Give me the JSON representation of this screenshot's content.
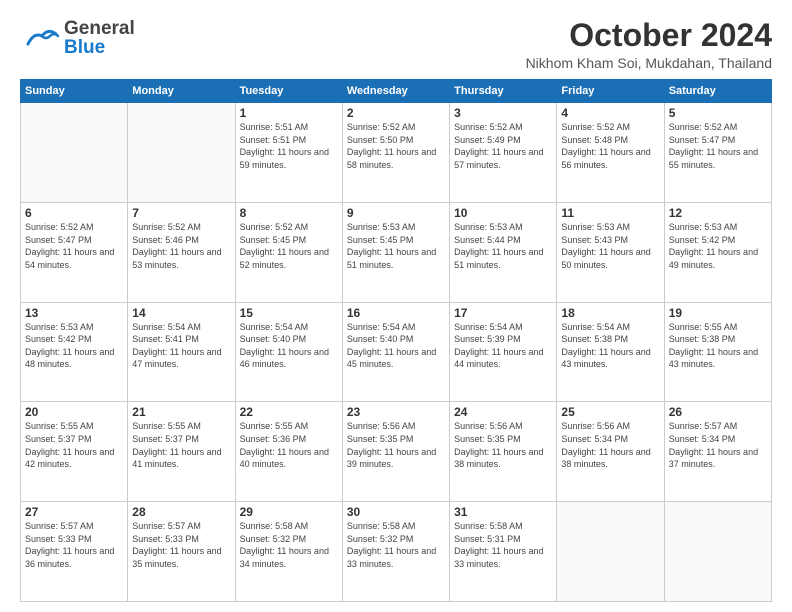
{
  "header": {
    "logo_line1": "General",
    "logo_line2": "Blue",
    "month": "October 2024",
    "location": "Nikhom Kham Soi, Mukdahan, Thailand"
  },
  "weekdays": [
    "Sunday",
    "Monday",
    "Tuesday",
    "Wednesday",
    "Thursday",
    "Friday",
    "Saturday"
  ],
  "weeks": [
    [
      {
        "day": "",
        "info": ""
      },
      {
        "day": "",
        "info": ""
      },
      {
        "day": "1",
        "info": "Sunrise: 5:51 AM\nSunset: 5:51 PM\nDaylight: 11 hours and 59 minutes."
      },
      {
        "day": "2",
        "info": "Sunrise: 5:52 AM\nSunset: 5:50 PM\nDaylight: 11 hours and 58 minutes."
      },
      {
        "day": "3",
        "info": "Sunrise: 5:52 AM\nSunset: 5:49 PM\nDaylight: 11 hours and 57 minutes."
      },
      {
        "day": "4",
        "info": "Sunrise: 5:52 AM\nSunset: 5:48 PM\nDaylight: 11 hours and 56 minutes."
      },
      {
        "day": "5",
        "info": "Sunrise: 5:52 AM\nSunset: 5:47 PM\nDaylight: 11 hours and 55 minutes."
      }
    ],
    [
      {
        "day": "6",
        "info": "Sunrise: 5:52 AM\nSunset: 5:47 PM\nDaylight: 11 hours and 54 minutes."
      },
      {
        "day": "7",
        "info": "Sunrise: 5:52 AM\nSunset: 5:46 PM\nDaylight: 11 hours and 53 minutes."
      },
      {
        "day": "8",
        "info": "Sunrise: 5:52 AM\nSunset: 5:45 PM\nDaylight: 11 hours and 52 minutes."
      },
      {
        "day": "9",
        "info": "Sunrise: 5:53 AM\nSunset: 5:45 PM\nDaylight: 11 hours and 51 minutes."
      },
      {
        "day": "10",
        "info": "Sunrise: 5:53 AM\nSunset: 5:44 PM\nDaylight: 11 hours and 51 minutes."
      },
      {
        "day": "11",
        "info": "Sunrise: 5:53 AM\nSunset: 5:43 PM\nDaylight: 11 hours and 50 minutes."
      },
      {
        "day": "12",
        "info": "Sunrise: 5:53 AM\nSunset: 5:42 PM\nDaylight: 11 hours and 49 minutes."
      }
    ],
    [
      {
        "day": "13",
        "info": "Sunrise: 5:53 AM\nSunset: 5:42 PM\nDaylight: 11 hours and 48 minutes."
      },
      {
        "day": "14",
        "info": "Sunrise: 5:54 AM\nSunset: 5:41 PM\nDaylight: 11 hours and 47 minutes."
      },
      {
        "day": "15",
        "info": "Sunrise: 5:54 AM\nSunset: 5:40 PM\nDaylight: 11 hours and 46 minutes."
      },
      {
        "day": "16",
        "info": "Sunrise: 5:54 AM\nSunset: 5:40 PM\nDaylight: 11 hours and 45 minutes."
      },
      {
        "day": "17",
        "info": "Sunrise: 5:54 AM\nSunset: 5:39 PM\nDaylight: 11 hours and 44 minutes."
      },
      {
        "day": "18",
        "info": "Sunrise: 5:54 AM\nSunset: 5:38 PM\nDaylight: 11 hours and 43 minutes."
      },
      {
        "day": "19",
        "info": "Sunrise: 5:55 AM\nSunset: 5:38 PM\nDaylight: 11 hours and 43 minutes."
      }
    ],
    [
      {
        "day": "20",
        "info": "Sunrise: 5:55 AM\nSunset: 5:37 PM\nDaylight: 11 hours and 42 minutes."
      },
      {
        "day": "21",
        "info": "Sunrise: 5:55 AM\nSunset: 5:37 PM\nDaylight: 11 hours and 41 minutes."
      },
      {
        "day": "22",
        "info": "Sunrise: 5:55 AM\nSunset: 5:36 PM\nDaylight: 11 hours and 40 minutes."
      },
      {
        "day": "23",
        "info": "Sunrise: 5:56 AM\nSunset: 5:35 PM\nDaylight: 11 hours and 39 minutes."
      },
      {
        "day": "24",
        "info": "Sunrise: 5:56 AM\nSunset: 5:35 PM\nDaylight: 11 hours and 38 minutes."
      },
      {
        "day": "25",
        "info": "Sunrise: 5:56 AM\nSunset: 5:34 PM\nDaylight: 11 hours and 38 minutes."
      },
      {
        "day": "26",
        "info": "Sunrise: 5:57 AM\nSunset: 5:34 PM\nDaylight: 11 hours and 37 minutes."
      }
    ],
    [
      {
        "day": "27",
        "info": "Sunrise: 5:57 AM\nSunset: 5:33 PM\nDaylight: 11 hours and 36 minutes."
      },
      {
        "day": "28",
        "info": "Sunrise: 5:57 AM\nSunset: 5:33 PM\nDaylight: 11 hours and 35 minutes."
      },
      {
        "day": "29",
        "info": "Sunrise: 5:58 AM\nSunset: 5:32 PM\nDaylight: 11 hours and 34 minutes."
      },
      {
        "day": "30",
        "info": "Sunrise: 5:58 AM\nSunset: 5:32 PM\nDaylight: 11 hours and 33 minutes."
      },
      {
        "day": "31",
        "info": "Sunrise: 5:58 AM\nSunset: 5:31 PM\nDaylight: 11 hours and 33 minutes."
      },
      {
        "day": "",
        "info": ""
      },
      {
        "day": "",
        "info": ""
      }
    ]
  ]
}
